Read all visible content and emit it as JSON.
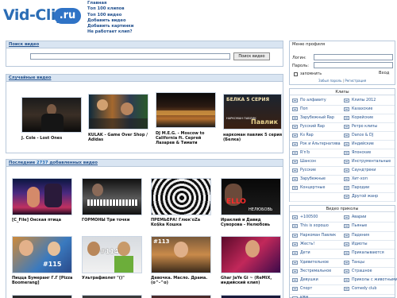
{
  "logo": {
    "main": "Vid-Clip",
    "tld": ".ru"
  },
  "topnav": [
    "Главная",
    "Топ 100 клипов",
    "Топ 100 видео",
    "Добавить видео",
    "Добавить картинки",
    "Не работает клип?"
  ],
  "search": {
    "title": "Поиск видео",
    "button": "Поиск видео",
    "value": ""
  },
  "random": {
    "title": "Случайные видео",
    "items": [
      {
        "caption": "J. Cole - Lost Ones"
      },
      {
        "caption": "KULAK - Game Over Shop / Adidas"
      },
      {
        "caption": "DJ M.E.G. - Moscow to California ft. Сергей Лазарев & Тимати"
      },
      {
        "caption": "наркоман павлик 5 серия (Белка)",
        "thumb_text": "БЕЛКА 5 СЕРИЯ",
        "thumb_sub": "Павлик",
        "thumb_small": "НАРКОМАН ПАВЛИК"
      }
    ]
  },
  "latest": {
    "title_prefix": "Последние",
    "count": "2737",
    "title_suffix": "добавленных видео",
    "row1": [
      {
        "caption": "[C_File] Онская птица"
      },
      {
        "caption": "ГОРМОНЫ Три точки"
      },
      {
        "caption": "ПРЕМЬЕРА! Глюк'oZa Ko$ka Кошка"
      },
      {
        "caption": "Ираклий и Давид Суворова - Нелюбовь",
        "thumb_text": "ELLO",
        "thumb_sub": "НЕЛЮБОВЬ"
      }
    ],
    "row2": [
      {
        "caption": "Пицца Бумеранг Г.Г [Pizza Boomerang]",
        "badge": "#115"
      },
      {
        "caption": "Ультрафиолет \"()\"",
        "badge": "#114"
      },
      {
        "caption": "Девочка. Масло. Драма. (o^-^o)",
        "badge": "#113"
      },
      {
        "caption": "Ghar JaYe Gi ~ (ReMiX, индийский клип)",
        "badge": ""
      }
    ]
  },
  "profile": {
    "title": "Меню профиля",
    "login_label": "Логин:",
    "password_label": "Пароль:",
    "remember": "запомнить",
    "enter": "Вход",
    "forgot": "Забыл пароль",
    "register": "Регистрация",
    "sep": "|"
  },
  "clips": {
    "title": "Клипы",
    "left": [
      "По алфавиту",
      "Поп",
      "Зарубежный Rap",
      "Русский Rap",
      "Кз Rap",
      "Рок и Альтернатива",
      "R'n'b",
      "Шансон",
      "Русские",
      "Зарубежные",
      "Концертные"
    ],
    "right": [
      "Клипы 2012",
      "Казахские",
      "Корейские",
      "Ретро клипы",
      "Dance & DJ",
      "Индийские",
      "Японские",
      "Инструментальные",
      "Саундтреки",
      "Хит-хоп",
      "Пародии",
      "Другой жанр"
    ]
  },
  "fun": {
    "title": "Видео приколы",
    "left": [
      "+100500",
      "This is хорошо",
      "Наркоман Павлик",
      "Жесть!",
      "Дети",
      "Удивительное",
      "Экстремальное",
      "Девушки",
      "Спорт",
      "КВН"
    ],
    "right": [
      "Аварии",
      "Пьяные",
      "Падения",
      "Идиоты",
      "Прикалываются",
      "Танцы",
      "Страшное",
      "Приколы с животными",
      "Comedy club"
    ]
  }
}
